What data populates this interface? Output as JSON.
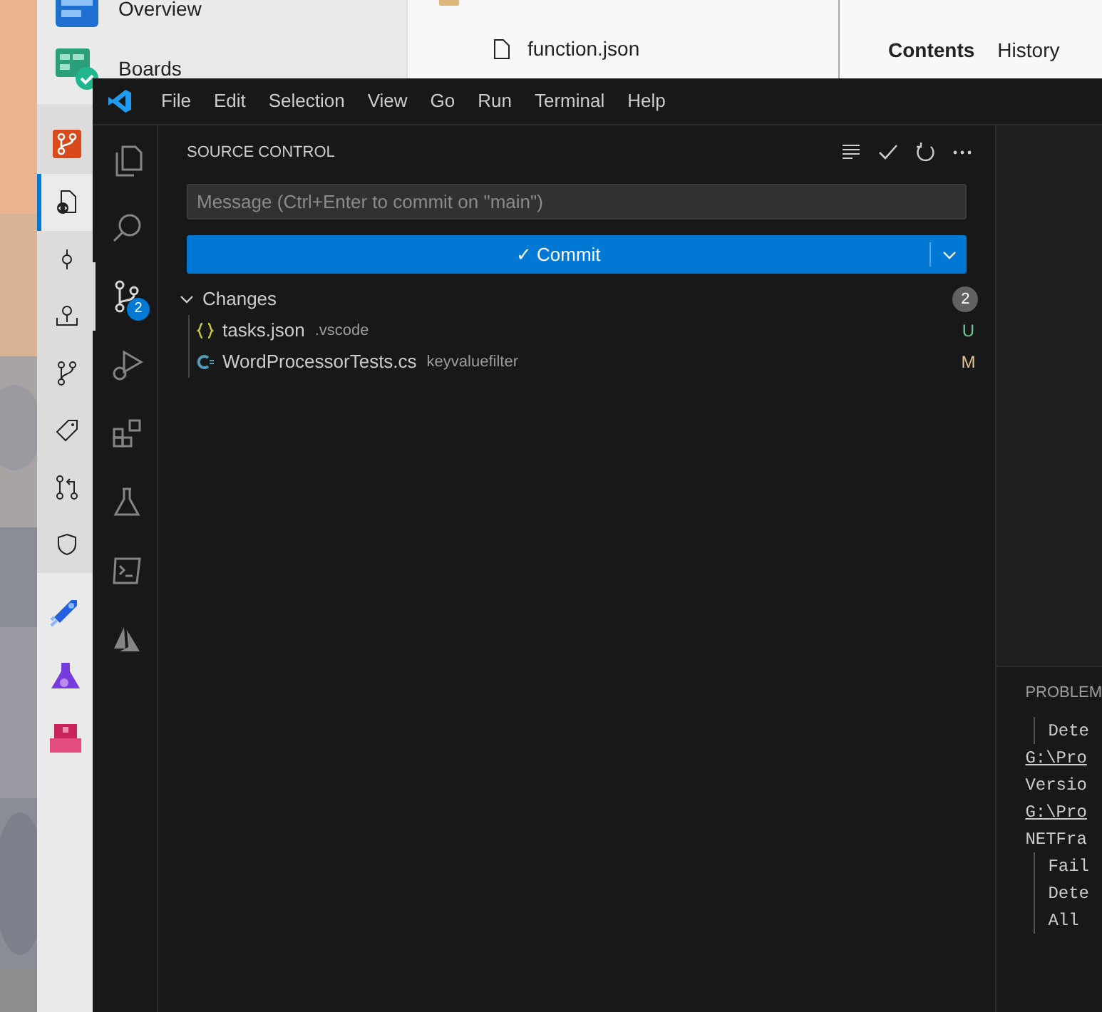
{
  "devops": {
    "nav": [
      {
        "label": "Overview"
      },
      {
        "label": "Boards"
      }
    ],
    "repos_items": [
      {
        "selected": true
      },
      {
        "selected": false
      },
      {
        "selected": false
      },
      {
        "selected": false
      },
      {
        "selected": false
      },
      {
        "selected": false
      },
      {
        "selected": false
      }
    ],
    "file_tree": [
      "function.json"
    ],
    "tabs": [
      {
        "label": "Contents",
        "selected": true
      },
      {
        "label": "History",
        "selected": false
      }
    ]
  },
  "vscode": {
    "menu": [
      "File",
      "Edit",
      "Selection",
      "View",
      "Go",
      "Run",
      "Terminal",
      "Help"
    ],
    "activity": [
      {
        "selected": false
      },
      {
        "selected": false
      },
      {
        "selected": true,
        "badge": "2"
      },
      {
        "selected": false
      },
      {
        "selected": false
      },
      {
        "selected": false
      },
      {
        "selected": false
      },
      {
        "selected": false
      }
    ],
    "source_control": {
      "title": "SOURCE CONTROL",
      "message": {
        "placeholder": "Message (Ctrl+Enter to commit on \"main\")"
      },
      "commit_button": "✓ Commit",
      "changes": {
        "label": "Changes",
        "expanded": true,
        "count": "2",
        "files": [
          {
            "name": "tasks.json",
            "folder": ".vscode",
            "kind": "json",
            "status": "U",
            "color": "#73c991"
          },
          {
            "name": "WordProcessorTests.cs",
            "folder": "keyvaluefilter",
            "kind": "csharp",
            "status": "M",
            "color": "#e2c08d"
          }
        ]
      }
    },
    "panel": {
      "tab": "PROBLEM",
      "lines": [
        {
          "text": "Dete",
          "kind": "indent"
        },
        {
          "text": "G:\\Pro",
          "kind": "link"
        },
        {
          "text": "Versio",
          "kind": "plain"
        },
        {
          "text": "G:\\Pro",
          "kind": "link"
        },
        {
          "text": "NETFra",
          "kind": "plain"
        },
        {
          "text": "Fail",
          "kind": "indent"
        },
        {
          "text": "Dete",
          "kind": "indent"
        },
        {
          "text": "All",
          "kind": "indent"
        }
      ]
    }
  }
}
